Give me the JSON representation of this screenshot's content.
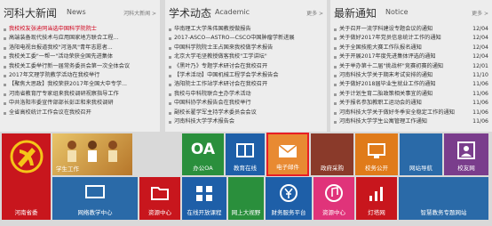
{
  "news": {
    "title": "河科大新闻",
    "subtitle": "News",
    "more": "河科大新闻 >",
    "items": [
      {
        "text": "我校校友张迪同当选中国科学院院士",
        "date": ""
      },
      {
        "text": "高端装备现代技术与应用国家地方联合工程...",
        "date": ""
      },
      {
        "text": "洛阳电视台报道我校\"河洛风\"青年志愿者...",
        "date": ""
      },
      {
        "text": "我校关工委\"一帮一\"活动荣获全国先进集体",
        "date": ""
      },
      {
        "text": "我校关工委举行新一届常务委员会第一次全体会议",
        "date": ""
      },
      {
        "text": "2017年文理学院教学活动在我校举行",
        "date": ""
      },
      {
        "text": "【聚焦大思政】我校荣获2017年全国大中专学...",
        "date": ""
      },
      {
        "text": "河南省教育厅专家组来我校调研视察指导工作",
        "date": ""
      },
      {
        "text": "中共洛阳市委宣传部部长彭正和来我校调研",
        "date": ""
      },
      {
        "text": "全省高校统计工作会议在我校召开",
        "date": ""
      }
    ]
  },
  "academic": {
    "title": "学术动态",
    "subtitle": "Academic",
    "more": "更多 >",
    "items": [
      {
        "text": "华南理工大学朱伟国教授做报告",
        "date": ""
      },
      {
        "text": "2017-ASCO—ASTRO—CSCO中国肿瘤学新进展",
        "date": ""
      },
      {
        "text": "中国科学院院士王占国来我校做学术报告",
        "date": ""
      },
      {
        "text": "北京大学毛坚教授做客我校\"工学讲坛\"",
        "date": ""
      },
      {
        "text": "《黑叶乃》专题学术研讨会在我校召开",
        "date": ""
      },
      {
        "text": "【学术活动】中国机械工程学会学术报告会",
        "date": ""
      },
      {
        "text": "洛阳院士工作站学术研讨会在我校召开",
        "date": ""
      },
      {
        "text": "我校与中科院联合主办学术活动",
        "date": ""
      },
      {
        "text": "中国科协学术报告会在我校举行",
        "date": ""
      },
      {
        "text": "副校长翟学军主持学术委员会会议",
        "date": ""
      },
      {
        "text": "河南科技大学学术报告会",
        "date": ""
      }
    ]
  },
  "notice": {
    "title": "最新通知",
    "subtitle": "Notice",
    "more": "更多 >",
    "items": [
      {
        "text": "关于召开一流学科建设专题会议的通知",
        "date": "12/04"
      },
      {
        "text": "关于做好2017年党员信息统计工作的通知",
        "date": "12/04"
      },
      {
        "text": "关于全国技能大赛工作队报名通知",
        "date": "12/04"
      },
      {
        "text": "关于开展2017年度先进集体评选的通知",
        "date": "12/04"
      },
      {
        "text": "关于举办第十二届\"挑战杯\"竞赛初赛的通知",
        "date": "12/01"
      },
      {
        "text": "河南科技大学关于期末考试安排的通知",
        "date": "11/10"
      },
      {
        "text": "关于做好2018届毕业生就业工作的通知",
        "date": "11/06"
      },
      {
        "text": "关于计划生育二胎政策相关事宜的通知",
        "date": "11/06"
      },
      {
        "text": "关于报名参加教职工运动会的通知",
        "date": "11/06"
      },
      {
        "text": "河南科技大学关于做好冬季安全稳定工作的通知",
        "date": "11/06"
      },
      {
        "text": "河南科技大学学生公寓管理工作通知",
        "date": "11/06"
      }
    ]
  },
  "tiles": {
    "party": "河南省委",
    "student": "学生工作",
    "oa_big": "OA",
    "oa": "办公OA",
    "edu": "教育在线",
    "mail": "电子邮件",
    "purchase": "政府采购",
    "open": "校务公开",
    "nav": "网站导航",
    "alumni": "校友网",
    "teach": "网络教学中心",
    "resource": "资源中心",
    "online": "在线开放课程",
    "library": "网上大视野",
    "finance": "财务服务平台",
    "music": "资源中心",
    "radio": "灯塔网",
    "digital": "智慧教务专题网站"
  },
  "colors": {
    "red": "#c8161d",
    "blue": "#1e5fa8",
    "green": "#2a8f3c",
    "orange": "#e07b1a",
    "purple": "#7a3d8c"
  }
}
